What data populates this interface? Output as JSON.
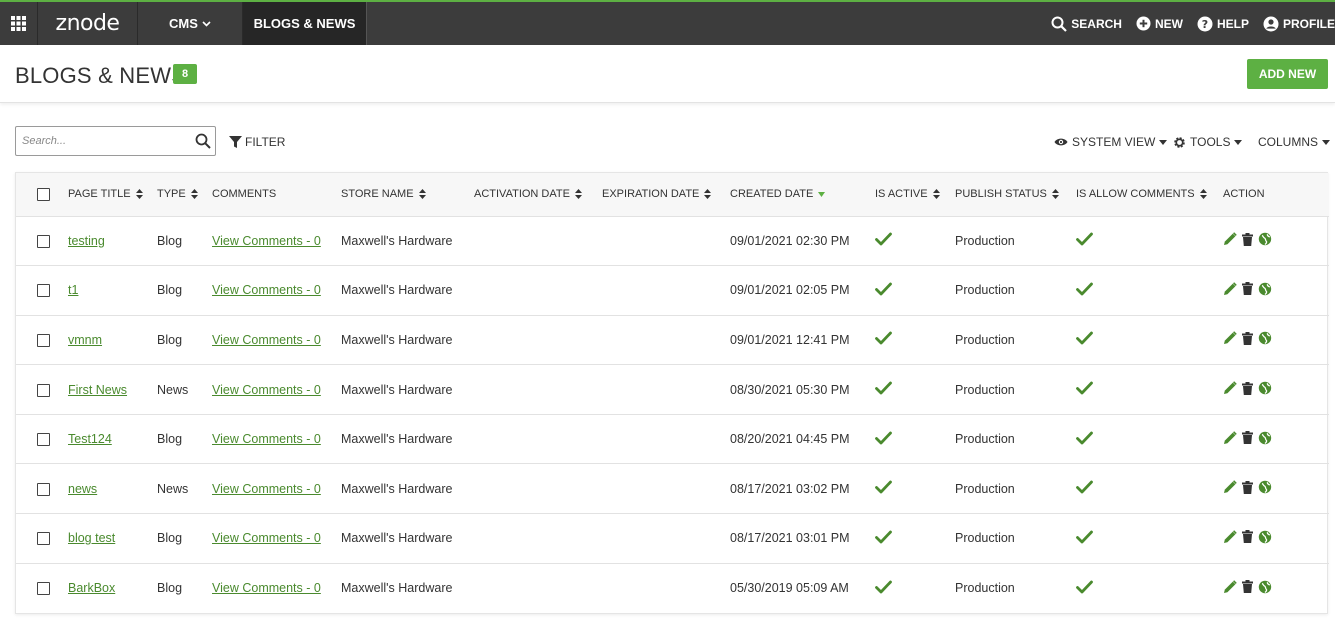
{
  "topbar": {
    "logo": "znode",
    "cms_label": "CMS",
    "active_label": "BLOGS & NEWS",
    "search_label": "SEARCH",
    "new_label": "NEW",
    "help_label": "HELP",
    "profile_label": "PROFILE"
  },
  "page": {
    "title": "BLOGS & NEWS",
    "count": "8",
    "add_new_label": "ADD NEW"
  },
  "toolbar": {
    "search_placeholder": "Search...",
    "filter_label": "FILTER",
    "system_view_label": "SYSTEM VIEW",
    "tools_label": "TOOLS",
    "columns_label": "COLUMNS"
  },
  "table": {
    "headers": {
      "page_title": "PAGE TITLE",
      "type": "TYPE",
      "comments": "COMMENTS",
      "store_name": "STORE NAME",
      "activation_date": "ACTIVATION DATE",
      "expiration_date": "EXPIRATION DATE",
      "created_date": "CREATED DATE",
      "is_active": "IS ACTIVE",
      "publish_status": "PUBLISH STATUS",
      "is_allow_comments": "IS ALLOW COMMENTS",
      "action": "ACTION"
    },
    "rows": [
      {
        "title": "testing",
        "type": "Blog",
        "comments": "View Comments - 0",
        "store": "Maxwell's Hardware",
        "created": "09/01/2021 02:30 PM",
        "status": "Production"
      },
      {
        "title": "t1",
        "type": "Blog",
        "comments": "View Comments - 0",
        "store": "Maxwell's Hardware",
        "created": "09/01/2021 02:05 PM",
        "status": "Production"
      },
      {
        "title": "vmnm",
        "type": "Blog",
        "comments": "View Comments - 0",
        "store": "Maxwell's Hardware",
        "created": "09/01/2021 12:41 PM",
        "status": "Production"
      },
      {
        "title": "First News",
        "type": "News",
        "comments": "View Comments - 0",
        "store": "Maxwell's Hardware",
        "created": "08/30/2021 05:30 PM",
        "status": "Production"
      },
      {
        "title": "Test124",
        "type": "Blog",
        "comments": "View Comments - 0",
        "store": "Maxwell's Hardware",
        "created": "08/20/2021 04:45 PM",
        "status": "Production"
      },
      {
        "title": "news",
        "type": "News",
        "comments": "View Comments - 0",
        "store": "Maxwell's Hardware",
        "created": "08/17/2021 03:02 PM",
        "status": "Production"
      },
      {
        "title": "blog test",
        "type": "Blog",
        "comments": "View Comments - 0",
        "store": "Maxwell's Hardware",
        "created": "08/17/2021 03:01 PM",
        "status": "Production"
      },
      {
        "title": "BarkBox",
        "type": "Blog",
        "comments": "View Comments - 0",
        "store": "Maxwell's Hardware",
        "created": "05/30/2019 05:09 AM",
        "status": "Production"
      }
    ]
  },
  "colors": {
    "accent": "#5db043",
    "link": "#4a8a2e",
    "topbar": "#3c3c3c"
  },
  "icons": {
    "apps": "grid-icon",
    "search": "search-icon",
    "new": "plus-circle-icon",
    "help": "help-icon",
    "profile": "user-icon",
    "filter": "filter-icon",
    "view": "eye-icon",
    "tools": "gear-icon",
    "edit": "pencil-icon",
    "delete": "trash-icon",
    "publish": "globe-icon",
    "active": "check-icon"
  }
}
